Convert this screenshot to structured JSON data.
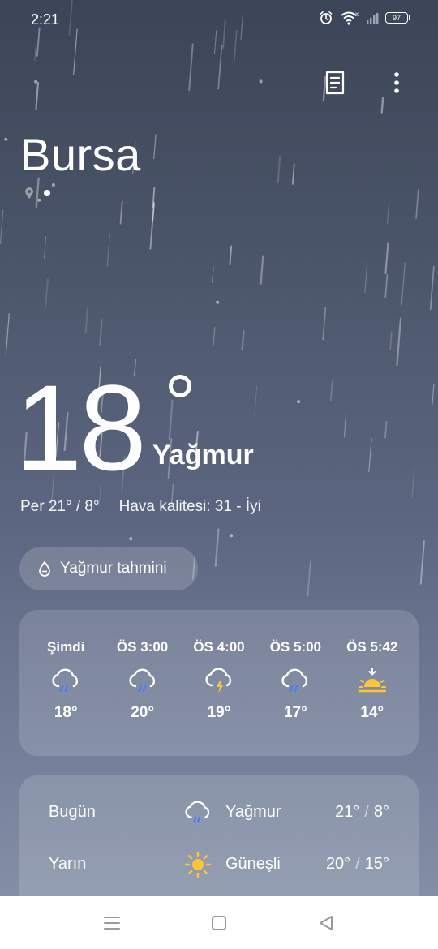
{
  "status_bar": {
    "time": "2:21",
    "battery": "97"
  },
  "header": {
    "city": "Bursa"
  },
  "current": {
    "temperature": "18",
    "condition": "Yağmur",
    "day_range": "Per 21° / 8°",
    "air_quality": "Hava kalitesi: 31 - İyi"
  },
  "rain_forecast_label": "Yağmur tahmini",
  "hourly": [
    {
      "time": "Şimdi",
      "icon": "rain-cloud-icon",
      "temp": "18°"
    },
    {
      "time": "ÖS 3:00",
      "icon": "rain-cloud-icon",
      "temp": "20°"
    },
    {
      "time": "ÖS 4:00",
      "icon": "thunder-cloud-icon",
      "temp": "19°"
    },
    {
      "time": "ÖS 5:00",
      "icon": "rain-cloud-icon",
      "temp": "17°"
    },
    {
      "time": "ÖS 5:42",
      "icon": "sunset-icon",
      "temp": "14°"
    }
  ],
  "daily": [
    {
      "day": "Bugün",
      "icon": "rain-cloud-icon",
      "condition": "Yağmur",
      "high": "21°",
      "low": "8°"
    },
    {
      "day": "Yarın",
      "icon": "sun-icon",
      "condition": "Güneşli",
      "high": "20°",
      "low": "15°"
    }
  ],
  "colors": {
    "rain_drop": "#4a7cff",
    "sun": "#ffc533",
    "lightning": "#ffc533"
  }
}
